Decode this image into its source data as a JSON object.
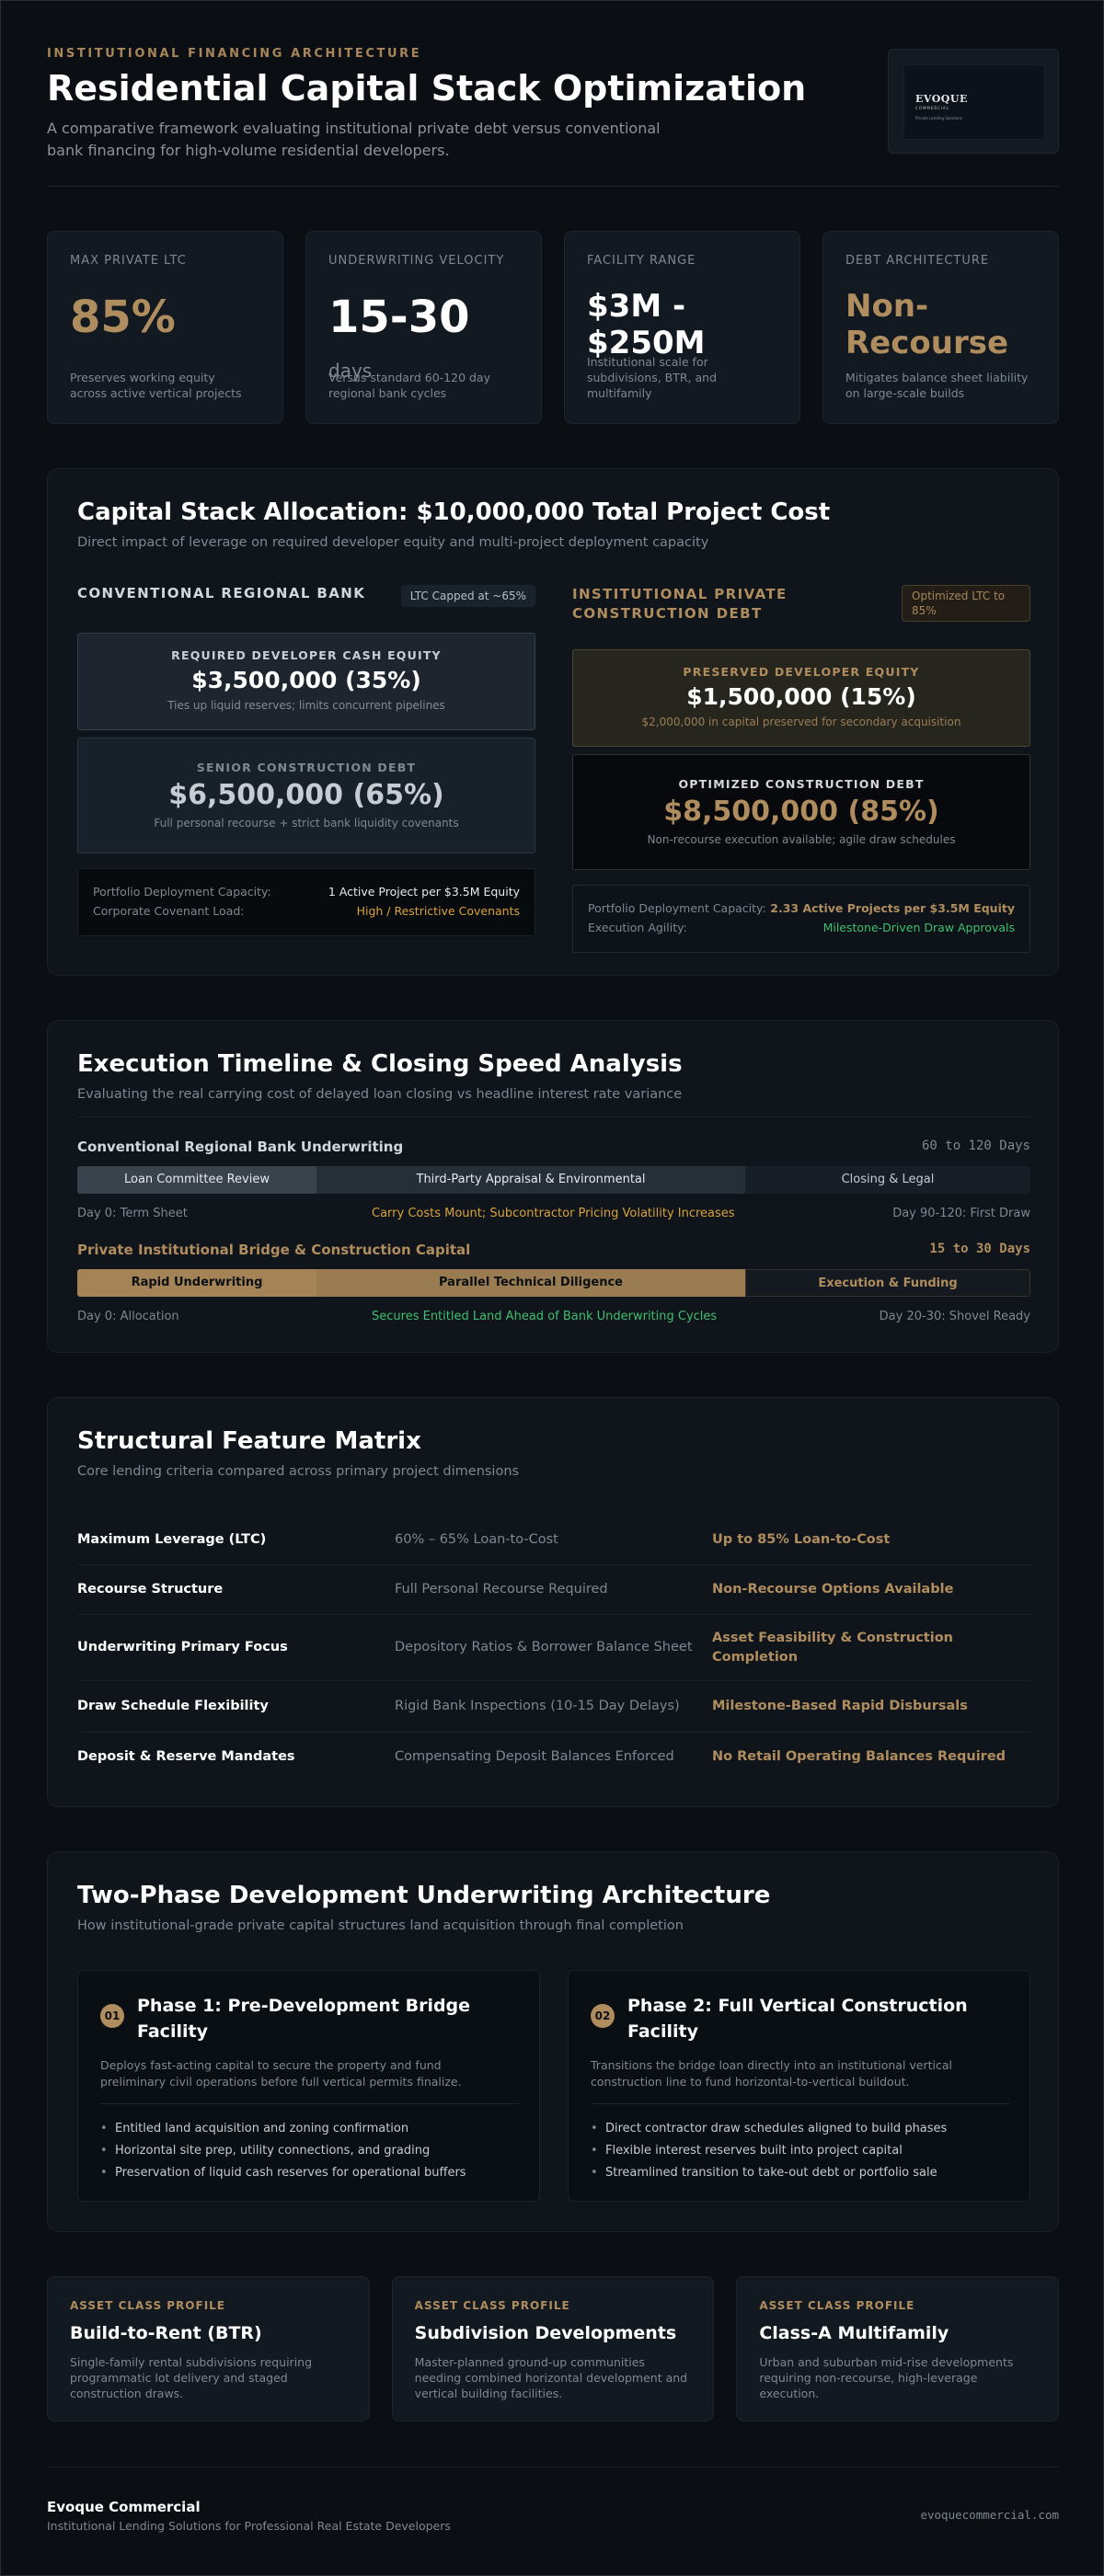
{
  "header": {
    "eyebrow": "INSTITUTIONAL FINANCING ARCHITECTURE",
    "title": "Residential Capital Stack Optimization",
    "subtitle": "A comparative framework evaluating institutional private debt versus conventional bank financing for high-volume residential developers.",
    "logo": {
      "name": "EVOQUE",
      "line2": "COMMERCIAL",
      "line3": "Private Lending Solutions"
    }
  },
  "stats": [
    {
      "label": "MAX PRIVATE LTC",
      "value": "85%",
      "unit": "",
      "desc": "Preserves working equity across active vertical projects"
    },
    {
      "label": "UNDERWRITING VELOCITY",
      "value": "15-30",
      "unit": "days",
      "desc": "Versus standard 60-120 day regional bank cycles"
    },
    {
      "label": "FACILITY RANGE",
      "value": "$3M - $250M",
      "unit": "",
      "desc": "Institutional scale for subdivisions, BTR, and multifamily"
    },
    {
      "label": "DEBT ARCHITECTURE",
      "value": "Non-Recourse",
      "unit": "",
      "desc": "Mitigates balance sheet liability on large-scale builds"
    }
  ],
  "capital_stack": {
    "title": "Capital Stack Allocation: $10,000,000 Total Project Cost",
    "subtitle": "Direct impact of leverage on required developer equity and multi-project deployment capacity",
    "bank": {
      "heading": "CONVENTIONAL REGIONAL BANK",
      "badge": "LTC Capped at ~65%",
      "equity": {
        "label": "REQUIRED DEVELOPER CASH EQUITY",
        "value": "$3,500,000 (35%)",
        "note": "Ties up liquid reserves; limits concurrent pipelines",
        "share": 0.35
      },
      "debt": {
        "label": "SENIOR CONSTRUCTION DEBT",
        "value": "$6,500,000 (65%)",
        "note": "Full personal recourse + strict bank liquidity covenants",
        "share": 0.65
      },
      "rows": [
        {
          "k": "Portfolio Deployment Capacity:",
          "v": "1 Active Project per $3.5M Equity"
        },
        {
          "k": "Corporate Covenant Load:",
          "v": "High / Restrictive Covenants"
        }
      ]
    },
    "private": {
      "heading": "INSTITUTIONAL PRIVATE CONSTRUCTION DEBT",
      "badge": "Optimized LTC to 85%",
      "equity": {
        "label": "PRESERVED DEVELOPER EQUITY",
        "value": "$1,500,000 (15%)",
        "note": "$2,000,000 in capital preserved for secondary acquisition",
        "share": 0.15
      },
      "debt": {
        "label": "OPTIMIZED CONSTRUCTION DEBT",
        "value": "$8,500,000 (85%)",
        "note": "Non-recourse execution available; agile draw schedules",
        "share": 0.85
      },
      "rows": [
        {
          "k": "Portfolio Deployment Capacity:",
          "v": "2.33 Active Projects per $3.5M Equity"
        },
        {
          "k": "Execution Agility:",
          "v": "Milestone-Driven Draw Approvals"
        }
      ]
    }
  },
  "timeline": {
    "title": "Execution Timeline & Closing Speed Analysis",
    "subtitle": "Evaluating the real carrying cost of delayed loan closing vs headline interest rate variance",
    "bank": {
      "name": "Conventional Regional Bank Underwriting",
      "duration": "60 to 120 Days",
      "segments": [
        "Loan Committee Review",
        "Third-Party Appraisal & Environmental",
        "Closing & Legal"
      ],
      "start": "Day 0: Term Sheet",
      "middle": "Carry Costs Mount; Subcontractor Pricing Volatility Increases",
      "end": "Day 90-120: First Draw"
    },
    "private": {
      "name": "Private Institutional Bridge & Construction Capital",
      "duration": "15 to 30 Days",
      "segments": [
        "Rapid Underwriting",
        "Parallel Technical Diligence",
        "Execution & Funding"
      ],
      "start": "Day 0: Allocation",
      "middle": "Secures Entitled Land Ahead of Bank Underwriting Cycles",
      "end": "Day 20-30: Shovel Ready"
    }
  },
  "matrix": {
    "title": "Structural Feature Matrix",
    "subtitle": "Core lending criteria compared across primary project dimensions",
    "rows": [
      {
        "feature": "Maximum Leverage (LTC)",
        "bank": "60% – 65% Loan-to-Cost",
        "private": "Up to 85% Loan-to-Cost"
      },
      {
        "feature": "Recourse Structure",
        "bank": "Full Personal Recourse Required",
        "private": "Non-Recourse Options Available"
      },
      {
        "feature": "Underwriting Primary Focus",
        "bank": "Depository Ratios & Borrower Balance Sheet",
        "private": "Asset Feasibility & Construction Completion"
      },
      {
        "feature": "Draw Schedule Flexibility",
        "bank": "Rigid Bank Inspections (10-15 Day Delays)",
        "private": "Milestone-Based Rapid Disbursals"
      },
      {
        "feature": "Deposit & Reserve Mandates",
        "bank": "Compensating Deposit Balances Enforced",
        "private": "No Retail Operating Balances Required"
      }
    ]
  },
  "phases": {
    "title": "Two-Phase Development Underwriting Architecture",
    "subtitle": "How institutional-grade private capital structures land acquisition through final completion",
    "items": [
      {
        "num": "01",
        "title": "Phase 1: Pre-Development Bridge Facility",
        "desc": "Deploys fast-acting capital to secure the property and fund preliminary civil operations before full vertical permits finalize.",
        "bullets": [
          "Entitled land acquisition and zoning confirmation",
          "Horizontal site prep, utility connections, and grading",
          "Preservation of liquid cash reserves for operational buffers"
        ]
      },
      {
        "num": "02",
        "title": "Phase 2: Full Vertical Construction Facility",
        "desc": "Transitions the bridge loan directly into an institutional vertical construction line to fund horizontal-to-vertical buildout.",
        "bullets": [
          "Direct contractor draw schedules aligned to build phases",
          "Flexible interest reserves built into project capital",
          "Streamlined transition to take-out debt or portfolio sale"
        ]
      }
    ]
  },
  "assets": [
    {
      "label": "ASSET CLASS PROFILE",
      "title": "Build-to-Rent (BTR)",
      "desc": "Single-family rental subdivisions requiring programmatic lot delivery and staged construction draws."
    },
    {
      "label": "ASSET CLASS PROFILE",
      "title": "Subdivision Developments",
      "desc": "Master-planned ground-up communities needing combined horizontal development and vertical building facilities."
    },
    {
      "label": "ASSET CLASS PROFILE",
      "title": "Class-A Multifamily",
      "desc": "Urban and suburban mid-rise developments requiring non-recourse, high-leverage execution."
    }
  ],
  "footer": {
    "brand": "Evoque Commercial",
    "tagline": "Institutional Lending Solutions for Professional Real Estate Developers",
    "url": "evoquecommercial.com"
  },
  "colors": {
    "accent": "#b08d5e",
    "background": "#0b0f13",
    "panel": "#0f151b",
    "warning": "#d9a23a",
    "success": "#3fbf6f"
  }
}
